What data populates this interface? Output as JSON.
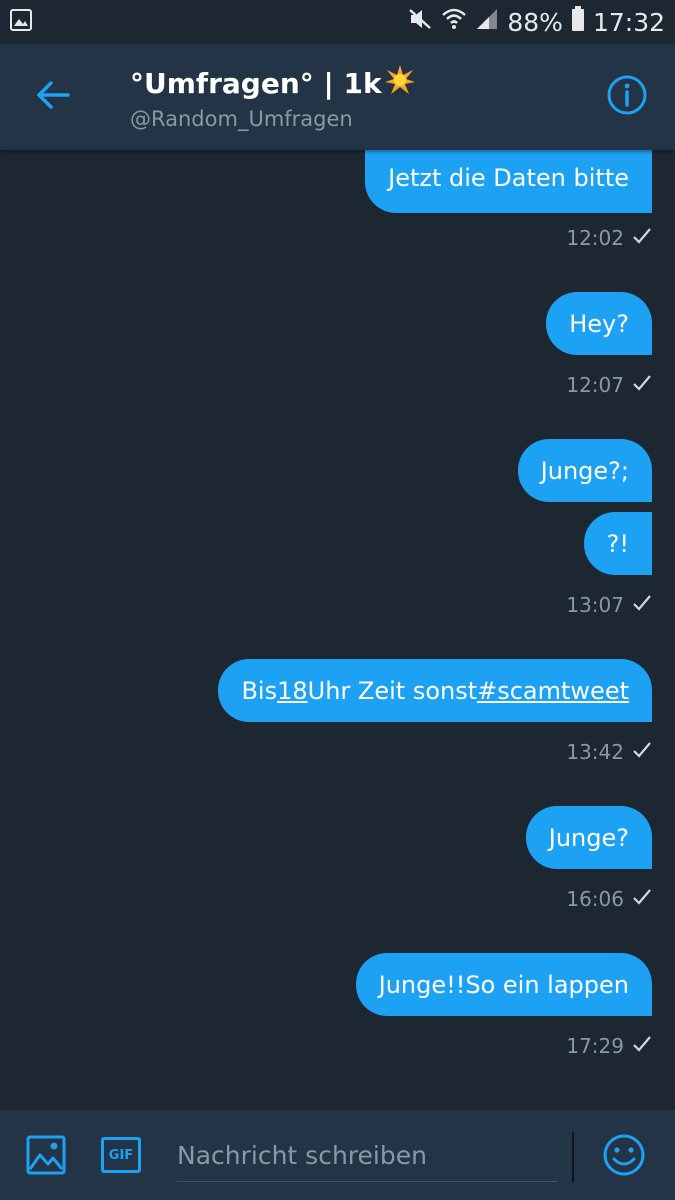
{
  "status_bar": {
    "battery": "88%",
    "time": "17:32"
  },
  "header": {
    "title": "°Umfragen° | 1k",
    "handle": "@Random_Umfragen"
  },
  "messages": [
    {
      "text": "Jetzt die Daten bitte",
      "time": "12:02"
    },
    {
      "text": "Hey?",
      "time": "12:07"
    },
    {
      "text": "Junge?;",
      "time": null
    },
    {
      "text": "?!",
      "time": "13:07"
    },
    {
      "text_parts": [
        "Bis ",
        "18",
        " Uhr Zeit sonst ",
        "#scamtweet"
      ],
      "time": "13:42"
    },
    {
      "text": "Junge?",
      "time": "16:06"
    },
    {
      "text": "Junge!!So ein lappen",
      "time": "17:29"
    }
  ],
  "composer": {
    "placeholder": "Nachricht schreiben",
    "gif_label": "GIF"
  },
  "colors": {
    "background": "#1c2732",
    "header": "#243447",
    "bubble": "#1da1f2",
    "accent": "#1da1f2",
    "muted": "#8899a6"
  },
  "icons": {
    "gallery": "image-icon",
    "mute": "mute-icon",
    "wifi": "wifi-icon",
    "signal": "signal-icon",
    "battery": "battery-icon",
    "back": "arrow-left-icon",
    "info": "info-icon",
    "sparkle": "sparkle-emoji",
    "check": "check-icon",
    "image_attach": "image-icon",
    "gif": "gif-icon",
    "emoji": "smiley-icon"
  }
}
